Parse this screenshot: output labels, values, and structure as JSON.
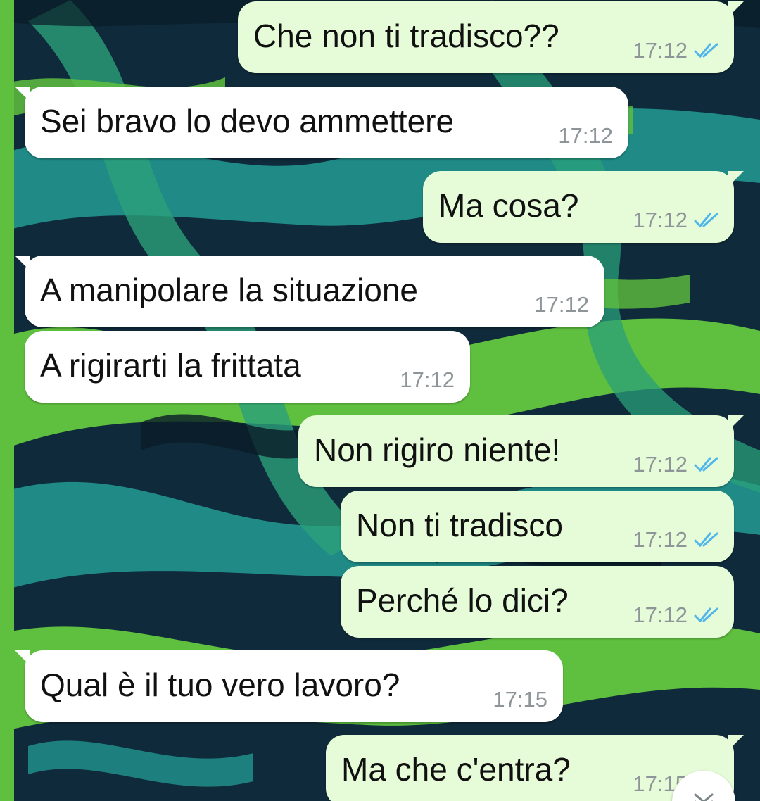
{
  "theme": {
    "incoming_bg": "#ffffff",
    "outgoing_bg": "#e6fcd8",
    "tick_read_color": "#4fb6ec",
    "wallpaper_dark": "#0f2a3a",
    "wallpaper_green": "#5fbf3f",
    "wallpaper_teal": "#1f8a86"
  },
  "messages": [
    {
      "direction": "out",
      "text": "Che non ti tradisco??",
      "time": "17:12",
      "status": "read"
    },
    {
      "direction": "in",
      "text": "Sei bravo lo devo ammettere",
      "time": "17:12"
    },
    {
      "direction": "out",
      "text": "Ma cosa?",
      "time": "17:12",
      "status": "read"
    },
    {
      "direction": "in",
      "text": "A manipolare la situazione",
      "time": "17:12"
    },
    {
      "direction": "in",
      "text": "A rigirarti la frittata",
      "time": "17:12"
    },
    {
      "direction": "out",
      "text": "Non rigiro niente!",
      "time": "17:12",
      "status": "read"
    },
    {
      "direction": "out",
      "text": "Non ti tradisco",
      "time": "17:12",
      "status": "read"
    },
    {
      "direction": "out",
      "text": "Perché lo dici?",
      "time": "17:12",
      "status": "read"
    },
    {
      "direction": "in",
      "text": "Qual è il tuo vero lavoro?",
      "time": "17:15"
    },
    {
      "direction": "out",
      "text": "Ma che c'entra?",
      "time": "17:15",
      "status": "read"
    }
  ],
  "scroll_button_icon": "double-chevron-down-icon"
}
